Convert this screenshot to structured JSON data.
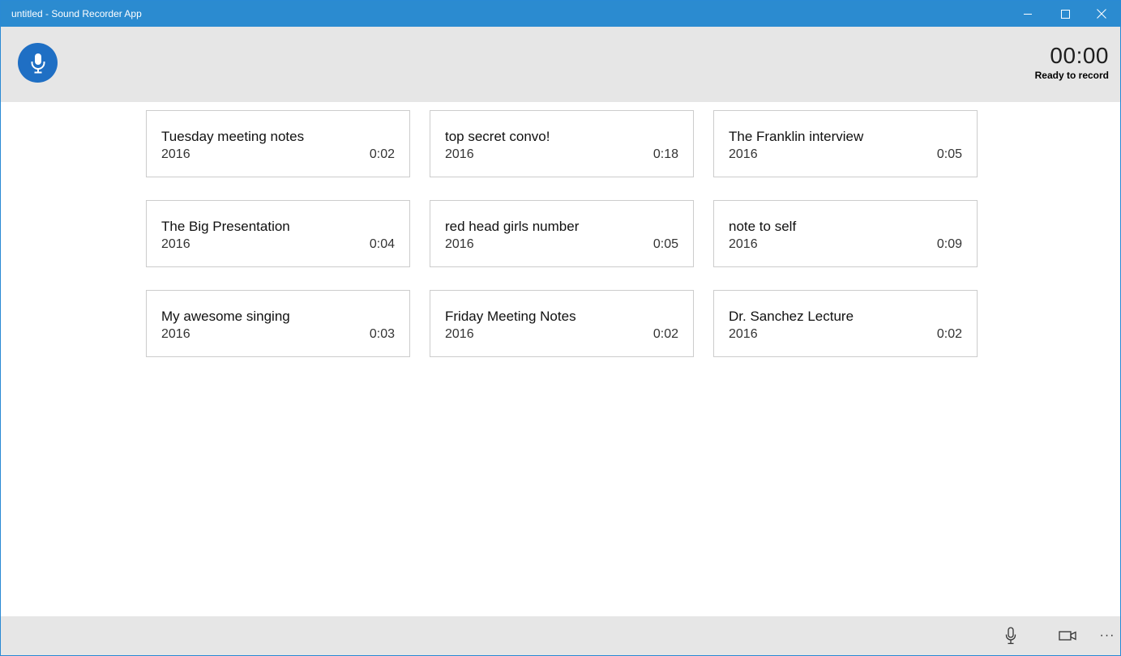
{
  "window": {
    "title": "untitled - Sound Recorder App",
    "controls": {
      "minimize": "minimize-icon",
      "maximize": "maximize-icon",
      "close": "close-icon"
    }
  },
  "header": {
    "record_icon": "microphone-icon",
    "timer": "00:00",
    "status": "Ready to record"
  },
  "recordings": [
    {
      "name": "Tuesday meeting notes",
      "year": "2016",
      "duration": "0:02"
    },
    {
      "name": "top secret convo!",
      "year": "2016",
      "duration": "0:18"
    },
    {
      "name": "The Franklin interview",
      "year": "2016",
      "duration": "0:05"
    },
    {
      "name": "The Big Presentation",
      "year": "2016",
      "duration": "0:04"
    },
    {
      "name": "red head girls number",
      "year": "2016",
      "duration": "0:05"
    },
    {
      "name": "note to self",
      "year": "2016",
      "duration": "0:09"
    },
    {
      "name": "My awesome singing",
      "year": "2016",
      "duration": "0:03"
    },
    {
      "name": "Friday Meeting Notes",
      "year": "2016",
      "duration": "0:02"
    },
    {
      "name": "Dr. Sanchez Lecture",
      "year": "2016",
      "duration": "0:02"
    }
  ],
  "appbar": {
    "mic_icon": "microphone-icon",
    "camera_icon": "video-camera-icon",
    "more_label": "···"
  },
  "colors": {
    "titlebar": "#2b8bd0",
    "accent": "#1f6fc4",
    "header_bg": "#e6e6e6",
    "card_border": "#cccccc"
  }
}
